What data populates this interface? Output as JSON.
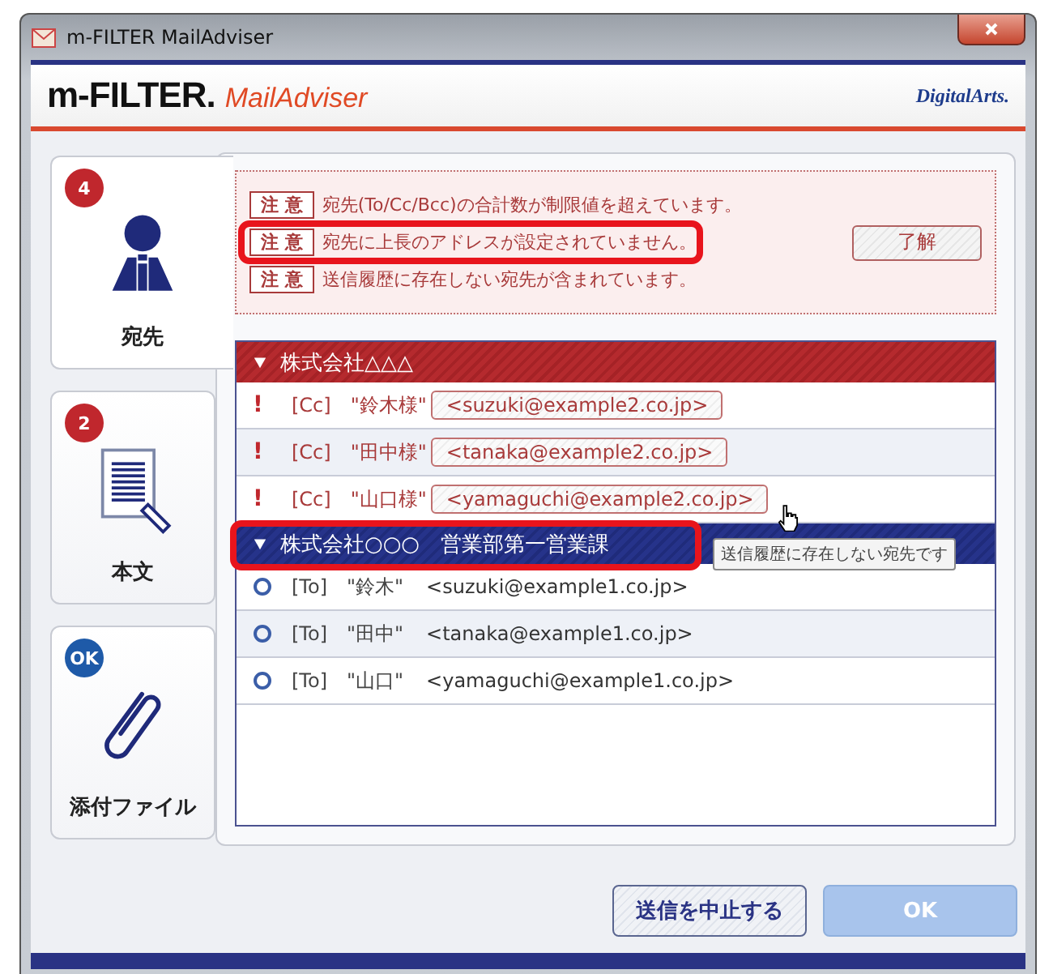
{
  "window": {
    "title": "m-FILTER MailAdviser"
  },
  "header": {
    "product": "m-FILTER.",
    "subtitle": "MailAdviser",
    "brand": "DigitalArts."
  },
  "categories": [
    {
      "label": "宛先",
      "badge": "4",
      "color": "#c0272d",
      "kind": "recipients",
      "selected": true
    },
    {
      "label": "本文",
      "badge": "2",
      "color": "#c0272d",
      "kind": "body",
      "selected": false
    },
    {
      "label": "添付ファイル",
      "badge": "OK",
      "color": "#1e5aa8",
      "kind": "attachment",
      "selected": false
    }
  ],
  "warnings": [
    {
      "tag": "注 意",
      "text": "宛先(To/Cc/Bcc)の合計数が制限値を超えています。",
      "highlighted": false
    },
    {
      "tag": "注 意",
      "text": "宛先に上長のアドレスが設定されていません。",
      "highlighted": true
    },
    {
      "tag": "注 意",
      "text": "送信履歴に存在しない宛先が含まれています。",
      "highlighted": false
    }
  ],
  "ack_button": "了解",
  "groups": [
    {
      "name": "株式会社△△△",
      "kind": "warning",
      "expanded": true,
      "highlighted": false,
      "recipients": [
        {
          "kind": "warning",
          "mark": "!",
          "type": "[Cc]",
          "name": "\"鈴木様\"",
          "address": "<suzuki@example2.co.jp>"
        },
        {
          "kind": "warning",
          "mark": "!",
          "type": "[Cc]",
          "name": "\"田中様\"",
          "address": "<tanaka@example2.co.jp>"
        },
        {
          "kind": "warning",
          "mark": "!",
          "type": "[Cc]",
          "name": "\"山口様\"",
          "address": "<yamaguchi@example2.co.jp>"
        }
      ]
    },
    {
      "name": "株式会社○○○　営業部第一営業課",
      "kind": "ok",
      "expanded": true,
      "highlighted": true,
      "recipients": [
        {
          "kind": "ok",
          "type": "[To]",
          "name": "\"鈴木\"",
          "address": "<suzuki@example1.co.jp>"
        },
        {
          "kind": "ok",
          "type": "[To]",
          "name": "\"田中\"",
          "address": "<tanaka@example1.co.jp>"
        },
        {
          "kind": "ok",
          "type": "[To]",
          "name": "\"山口\"",
          "address": "<yamaguchi@example1.co.jp>"
        }
      ]
    }
  ],
  "tooltip": {
    "text": "送信履歴に存在しない宛先です"
  },
  "buttons": [
    {
      "label": "送信を中止する",
      "disabled": false
    },
    {
      "label": "OK",
      "disabled": true
    }
  ]
}
